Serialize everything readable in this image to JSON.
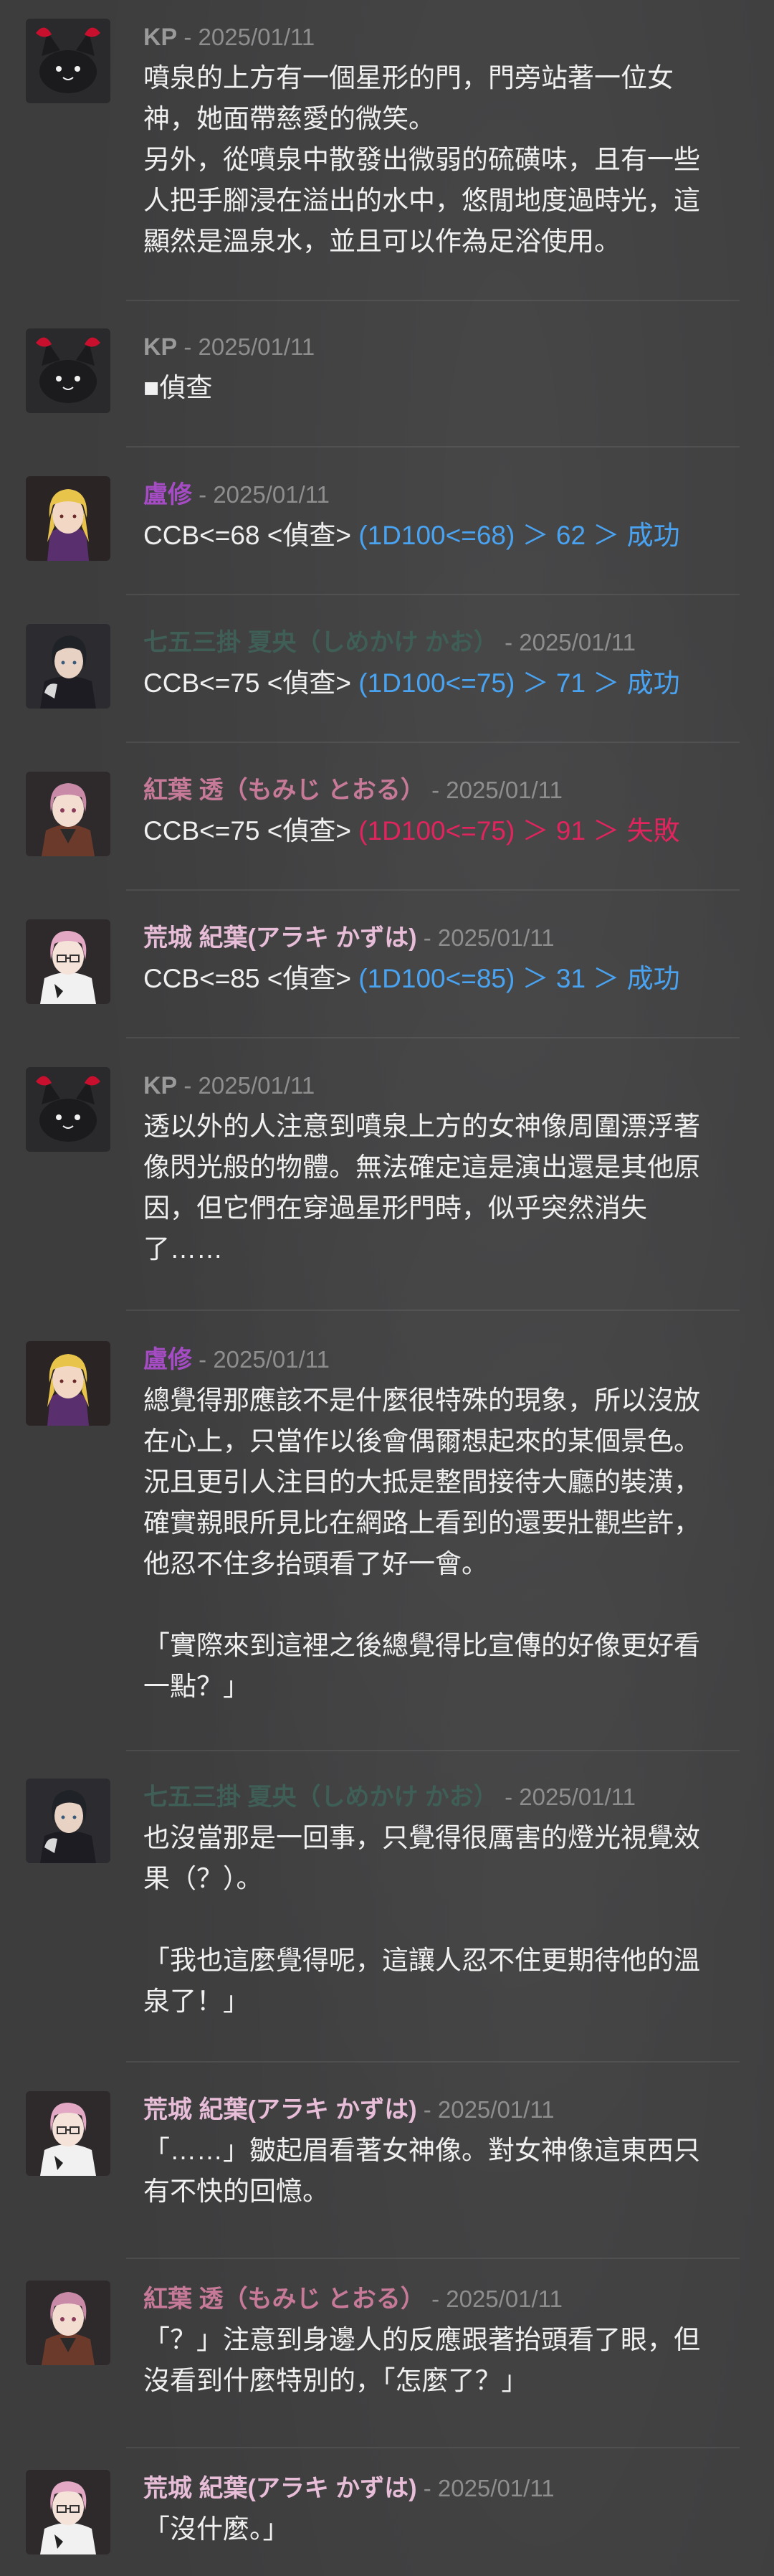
{
  "colors": {
    "kp": "#9a9a9a",
    "lu_xiu": "#a54cc4",
    "natsuo": "#3e5e56",
    "momiji": "#c77a98",
    "araki": "#e7bdd8",
    "success": "#4aa3f0",
    "failure": "#e0245e"
  },
  "messages": [
    {
      "avatar": "black-cat-avatar",
      "speaker": "KP",
      "date": "- 2025/01/11",
      "lines": [
        "噴泉的上方有一個星形的門，門旁站著一位女",
        "神，她面帶慈愛的微笑。",
        "另外，從噴泉中散發出微弱的硫磺味，且有一些",
        "人把手腳浸在溢出的水中，悠閒地度過時光，這",
        "顯然是溫泉水，並且可以作為足浴使用。"
      ]
    },
    {
      "avatar": "black-cat-avatar",
      "speaker": "KP",
      "date": "- 2025/01/11",
      "lines": [
        "■偵查"
      ]
    },
    {
      "avatar": "blonde-character-avatar",
      "speaker": "盧修",
      "date": "- 2025/01/11",
      "roll": "CCB<=68 <偵查> ",
      "result": "(1D100<=68) ＞ 62 ＞ 成功",
      "result_type": "success"
    },
    {
      "avatar": "dark-hair-character-avatar",
      "speaker": "七五三掛 夏央（しめかけ かお）",
      "date": "- 2025/01/11",
      "roll": "CCB<=75 <偵查> ",
      "result": "(1D100<=75) ＞ 71 ＞ 成功",
      "result_type": "success"
    },
    {
      "avatar": "pink-hair-kimono-avatar",
      "speaker": "紅葉 透（もみじ とおる）",
      "date": "- 2025/01/11",
      "roll": "CCB<=75 <偵查> ",
      "result": "(1D100<=75) ＞ 91 ＞ 失敗",
      "result_type": "failure"
    },
    {
      "avatar": "pink-hair-glasses-avatar",
      "speaker": "荒城 紀葉(アラキ かずは)",
      "date": "- 2025/01/11",
      "roll": "CCB<=85 <偵查> ",
      "result": "(1D100<=85) ＞ 31 ＞ 成功",
      "result_type": "success"
    },
    {
      "avatar": "black-cat-avatar",
      "speaker": "KP",
      "date": "- 2025/01/11",
      "lines": [
        "透以外的人注意到噴泉上方的女神像周圍漂浮著",
        "像閃光般的物體。無法確定這是演出還是其他原",
        "因，但它們在穿過星形門時，似乎突然消失",
        "了……"
      ]
    },
    {
      "avatar": "blonde-character-avatar",
      "speaker": "盧修",
      "date": "- 2025/01/11",
      "lines": [
        "總覺得那應該不是什麼很特殊的現象，所以沒放",
        "在心上，只當作以後會偶爾想起來的某個景色。",
        "況且更引人注目的大抵是整間接待大廳的裝潢，",
        "確實親眼所見比在網路上看到的還要壯觀些許，",
        "他忍不住多抬頭看了好一會。",
        "",
        "「實際來到這裡之後總覺得比宣傳的好像更好看",
        "一點？」"
      ]
    },
    {
      "avatar": "dark-hair-character-avatar",
      "speaker": "七五三掛 夏央（しめかけ かお）",
      "date": "- 2025/01/11",
      "lines": [
        "也沒當那是一回事，只覺得很厲害的燈光視覺效",
        "果（？）。",
        "",
        "「我也這麼覺得呢，這讓人忍不住更期待他的溫",
        "泉了！」"
      ]
    },
    {
      "avatar": "pink-hair-glasses-avatar",
      "speaker": "荒城 紀葉(アラキ かずは)",
      "date": "- 2025/01/11",
      "lines": [
        "「……」皺起眉看著女神像。對女神像這東西只",
        "有不快的回憶。"
      ]
    },
    {
      "avatar": "pink-hair-kimono-avatar",
      "speaker": "紅葉 透（もみじ とおる）",
      "date": "- 2025/01/11",
      "lines": [
        "「？」注意到身邊人的反應跟著抬頭看了眼，但",
        "沒看到什麼特別的，「怎麼了？」"
      ]
    },
    {
      "avatar": "pink-hair-glasses-avatar",
      "speaker": "荒城 紀葉(アラキ かずは)",
      "date": "- 2025/01/11",
      "lines": [
        "「沒什麼。」"
      ]
    }
  ]
}
